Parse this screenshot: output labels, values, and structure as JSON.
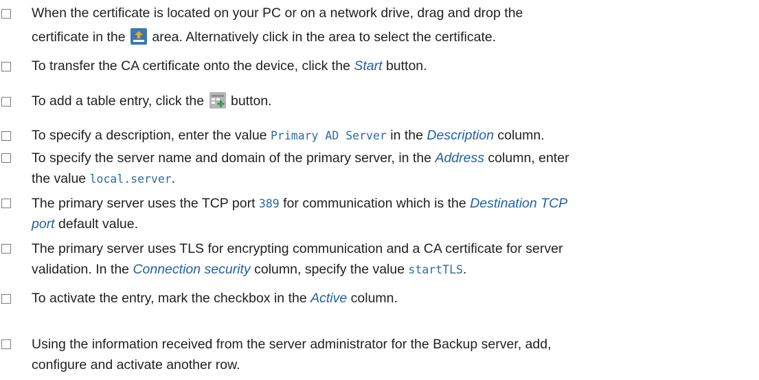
{
  "steps": [
    {
      "line1": "When the certificate is located on your PC or on a network drive, drag and drop the",
      "line2_a": "certificate in the",
      "upload_icon": "upload-arrow-icon",
      "line2_b": "area. Alternatively click in the area to select the certificate."
    },
    {
      "a": "To transfer the CA certificate onto the device, click the",
      "em": "Start",
      "b": "button."
    },
    {
      "a": "To add a table entry, click the",
      "icon": "add-table-row-icon",
      "b": "button."
    },
    {
      "a": "To specify a description, enter the value",
      "code": "Primary AD Server",
      "b": "in the",
      "em": "Description",
      "c": "column."
    },
    {
      "line1_a": "To specify the server name and domain of the primary server, in the",
      "em": "Address",
      "line1_b": "column, enter",
      "line2_a": "the value",
      "code": "local.server",
      "line2_b": "."
    },
    {
      "line1_a": "The primary server uses the TCP port",
      "code": "389",
      "line1_b": "for communication which is the",
      "em1": "Destination TCP",
      "em2": "port",
      "line2_b": "default value."
    },
    {
      "line1": "The primary server uses TLS for encrypting communication and a CA certificate for server",
      "line2_a": "validation. In the",
      "em": "Connection security",
      "line2_b": "column, specify the value",
      "code": "startTLS",
      "line2_c": "."
    },
    {
      "a": "To activate the entry, mark the checkbox in the",
      "em": "Active",
      "b": "column."
    },
    {
      "line1": "Using the information received from the server administrator for the Backup server, add,",
      "line2": "configure and activate another row."
    }
  ],
  "colors": {
    "emphasis": "#1f5fa8",
    "code": "#2a6aa3",
    "checkbox_border": "#7a7a7a",
    "upload_icon_bg": "#3b78b4",
    "upload_arrow": "#f2a41f"
  }
}
